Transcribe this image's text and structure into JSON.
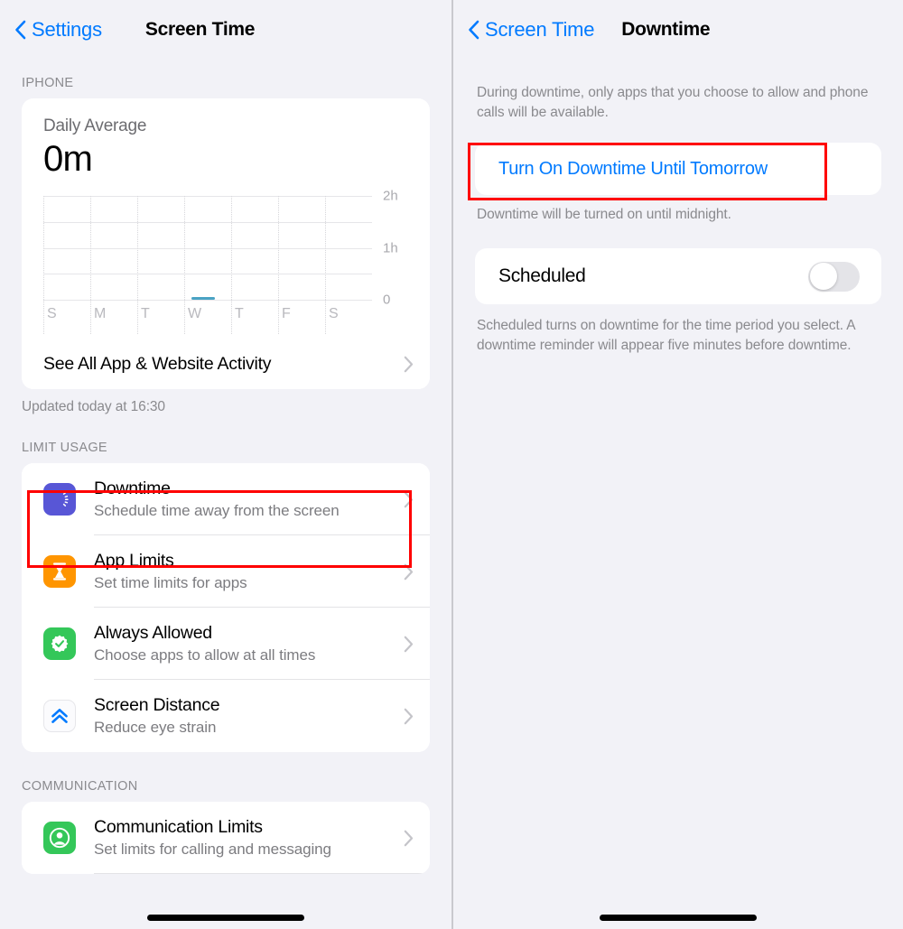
{
  "left_panel": {
    "nav": {
      "back_label": "Settings",
      "back_icon": "chevron-left-icon",
      "title": "Screen Time"
    },
    "iphone_section": {
      "header": "IPHONE",
      "usage_card": {
        "label": "Daily Average",
        "value": "0m"
      },
      "see_all_row": {
        "label": "See All App & Website Activity",
        "chevron": "chevron-right-icon"
      },
      "footnote": "Updated today at 16:30"
    },
    "limit_usage_section": {
      "header": "LIMIT USAGE",
      "items": [
        {
          "title": "Downtime",
          "subtitle": "Schedule time away from the screen",
          "icon": "downtime-moon-icon",
          "icon_color": "#5856d6",
          "highlighted": true
        },
        {
          "title": "App Limits",
          "subtitle": "Set time limits for apps",
          "icon": "hourglass-icon",
          "icon_color": "#ff9500",
          "highlighted": false
        },
        {
          "title": "Always Allowed",
          "subtitle": "Choose apps to allow at all times",
          "icon": "checkmark-seal-icon",
          "icon_color": "#34c759",
          "highlighted": false
        },
        {
          "title": "Screen Distance",
          "subtitle": "Reduce eye strain",
          "icon": "double-chevron-up-icon",
          "icon_color": "#007aff",
          "highlighted": false
        }
      ]
    },
    "communication_section": {
      "header": "COMMUNICATION",
      "items": [
        {
          "title": "Communication Limits",
          "subtitle": "Set limits for calling and messaging",
          "icon": "person-circle-icon",
          "icon_color": "#34c759"
        }
      ]
    }
  },
  "right_panel": {
    "nav": {
      "back_label": "Screen Time",
      "back_icon": "chevron-left-icon",
      "title": "Downtime"
    },
    "intro_text": "During downtime, only apps that you choose to allow and phone calls will be available.",
    "turn_on_row": {
      "label": "Turn On Downtime Until Tomorrow",
      "highlighted": true
    },
    "turn_on_footnote": "Downtime will be turned on until midnight.",
    "scheduled_row": {
      "label": "Scheduled",
      "toggle_state": "off"
    },
    "scheduled_footnote": "Scheduled turns on downtime for the time period you select. A downtime reminder will appear five minutes before downtime."
  },
  "chart_data": {
    "type": "bar",
    "title": "Daily Average",
    "subtitle": "0m",
    "categories": [
      "S",
      "M",
      "T",
      "W",
      "T",
      "F",
      "S"
    ],
    "values": [
      0,
      0,
      0,
      0.04,
      0,
      0,
      0
    ],
    "ytick_labels": [
      "2h",
      "1h",
      "0"
    ],
    "ytick_values": [
      2,
      1,
      0
    ],
    "gridline_values": [
      0,
      0.5,
      1,
      1.5,
      2
    ],
    "ylim": [
      0,
      2
    ],
    "ylabel": "",
    "xlabel": "",
    "bar_color": "#4aa3c4",
    "grid": true,
    "legend": "none"
  },
  "colors": {
    "accent_blue": "#007aff",
    "background": "#f2f2f7",
    "card": "#ffffff",
    "highlight_red": "#ff0000",
    "secondary_text": "#8a8a8e"
  }
}
